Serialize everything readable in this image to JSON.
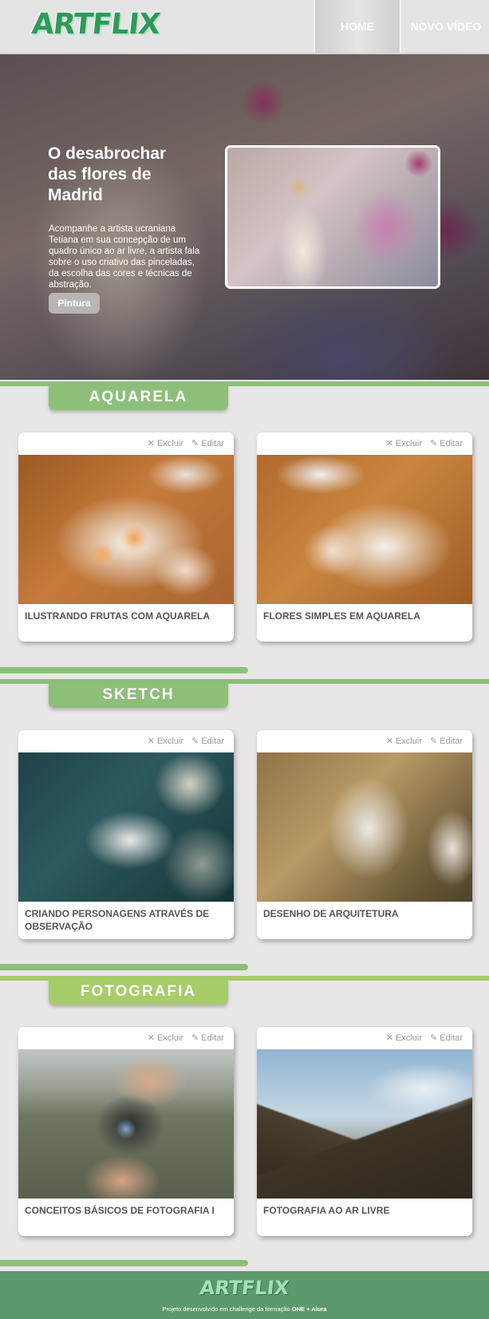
{
  "header": {
    "logo": "ARTFLIX",
    "nav": [
      {
        "label": "HOME"
      },
      {
        "label": "NOVO VÍDEO"
      }
    ]
  },
  "hero": {
    "title": "O desabrochar das flores de Madrid",
    "description": "Acompanhe a artista ucraniana Tetiana em sua concepção de um quadro único ao ar livre, a artista fala sobre o uso criativo das pinceladas, da escolha das cores e técnicas de abstração.",
    "tag": "Pintura"
  },
  "card_actions": {
    "delete_label": "Excluir",
    "edit_label": "Editar",
    "delete_icon": "close-icon",
    "edit_icon": "edit-icon"
  },
  "sections": [
    {
      "title": "AQUARELA",
      "color": "#8dbf7a",
      "cards": [
        {
          "title": "ILUSTRANDO FRUTAS COM AQUARELA"
        },
        {
          "title": "FLORES SIMPLES EM AQUARELA"
        }
      ]
    },
    {
      "title": "SKETCH",
      "color": "#8dbf7a",
      "cards": [
        {
          "title": "CRIANDO PERSONAGENS ATRAVÉS DE OBSERVAÇÃO"
        },
        {
          "title": "DESENHO DE ARQUITETURA"
        }
      ]
    },
    {
      "title": "FOTOGRAFIA",
      "color": "#a7cc6a",
      "cards": [
        {
          "title": "CONCEITOS BÁSICOS DE FOTOGRAFIA I"
        },
        {
          "title": "FOTOGRAFIA AO AR LIVRE"
        }
      ]
    }
  ],
  "colors": {
    "background": "#e8e6e7",
    "logo_green": "#2f9a5b",
    "footer_green": "#5c9a6b",
    "section_green": "#8dbf7a",
    "section_lime": "#a7cc6a"
  },
  "footer": {
    "logo": "ARTFLIX",
    "text": "Projeto desenvolvido em challenge da formação",
    "text_bold": "ONE + Alura"
  }
}
